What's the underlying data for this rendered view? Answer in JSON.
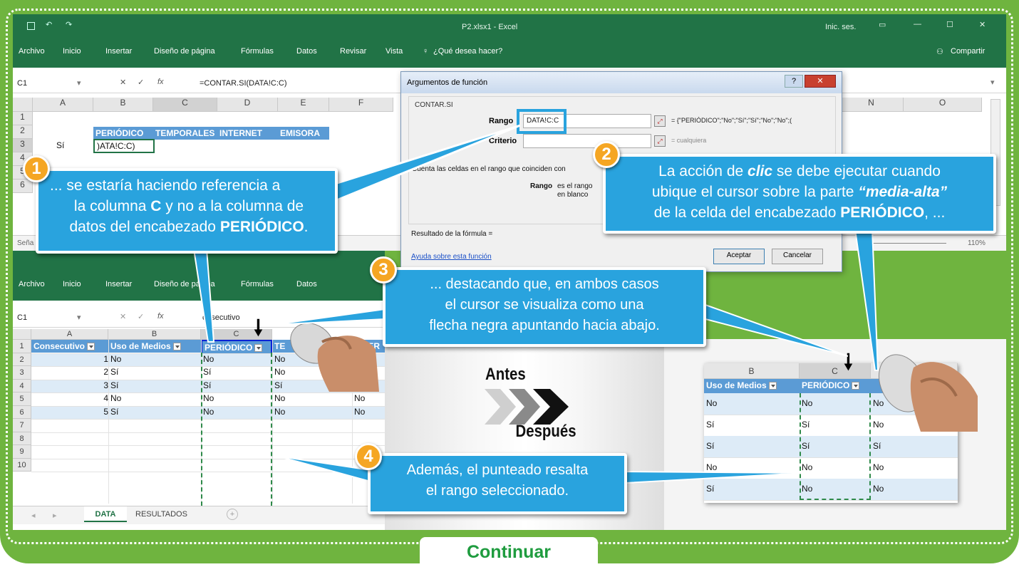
{
  "top_excel": {
    "title": "P2.xlsx1 - Excel",
    "signin": "Inic. ses.",
    "menu": [
      "Archivo",
      "Inicio",
      "Insertar",
      "Diseño de página",
      "Fórmulas",
      "Datos",
      "Revisar",
      "Vista"
    ],
    "search": "¿Qué desea hacer?",
    "share": "Compartir",
    "namebox": "C1",
    "formula": "=CONTAR.SI(DATA!C:C)",
    "cols": [
      "A",
      "B",
      "C",
      "D",
      "E",
      "F"
    ],
    "right_cols": [
      "N",
      "O"
    ],
    "rows": [
      "1",
      "2",
      "3",
      "4",
      "5",
      "6"
    ],
    "row2_b": "PERIÓDICO",
    "row2_c": "TEMPORALES",
    "row2_d": "INTERNET",
    "row2_e": "EMISORA",
    "row3_a": "Sí",
    "row3_b": ")ATA!C:C)",
    "status": "Seña",
    "zoom": "110%"
  },
  "dialog": {
    "title": "Argumentos de función",
    "func": "CONTAR.SI",
    "rango_label": "Rango",
    "rango_value": "DATA!C:C",
    "rango_result": "= {\"PERIÓDICO\";\"No\";\"Sí\";\"Sí\";\"No\";\"No\";(",
    "criterio_label": "Criterio",
    "criterio_result": "= cualquiera",
    "desc": "Cuenta las celdas en el rango que coinciden con",
    "rango_desc_label": "Rango",
    "rango_desc": "es el rango",
    "rango_desc2": "en blanco",
    "result_label": "Resultado de la fórmula =",
    "help_link": "Ayuda sobre esta función",
    "ok": "Aceptar",
    "cancel": "Cancelar"
  },
  "bottom_excel": {
    "menu": [
      "Archivo",
      "Inicio",
      "Insertar",
      "Diseño de página",
      "Fórmulas",
      "Datos"
    ],
    "namebox": "C1",
    "formula": "onsecutivo",
    "cols": [
      "A",
      "B",
      "C"
    ],
    "rows": [
      "1",
      "2",
      "3",
      "4",
      "5",
      "6",
      "7",
      "8",
      "9",
      "10"
    ],
    "headers": [
      "Consecutivo",
      "Uso de Medios",
      "PERIÓDICO",
      "TE",
      "INTER"
    ],
    "data": [
      [
        "1",
        "No",
        "No",
        "No",
        "No"
      ],
      [
        "2",
        "Sí",
        "Sí",
        "No",
        "No"
      ],
      [
        "3",
        "Sí",
        "Sí",
        "Sí",
        "No"
      ],
      [
        "4",
        "No",
        "No",
        "No",
        "No"
      ],
      [
        "5",
        "Sí",
        "No",
        "No",
        "No"
      ]
    ],
    "sheet_tabs": [
      "DATA",
      "RESULTADOS"
    ]
  },
  "right_excerpt": {
    "cols": [
      "B",
      "C"
    ],
    "headers": [
      "Uso de Medios",
      "PERIÓDICO"
    ],
    "data": [
      [
        "No",
        "No",
        "No"
      ],
      [
        "Sí",
        "Sí",
        "No"
      ],
      [
        "Sí",
        "Sí",
        "Sí"
      ],
      [
        "No",
        "No",
        "No"
      ],
      [
        "Sí",
        "No",
        "No"
      ]
    ]
  },
  "antes": "Antes",
  "despues": "Después",
  "callouts": {
    "c1_num": "1",
    "c1_a": "... se estaría haciendo referencia a",
    "c1_b1": "la columna ",
    "c1_b2": "C",
    "c1_b3": " y no a la columna de",
    "c1_c1": "datos del encabezado ",
    "c1_c2": "PERIÓDICO",
    "c1_c3": ".",
    "c2_num": "2",
    "c2_a1": "La acción de ",
    "c2_a2": "clic",
    "c2_a3": " se debe ejecutar cuando",
    "c2_b1": "ubique el cursor sobre la parte ",
    "c2_b2": "“media-alta”",
    "c2_c1": "de la celda del encabezado ",
    "c2_c2": "PERIÓDICO",
    "c2_c3": ", ...",
    "c3_num": "3",
    "c3_a": "... destacando que, en ambos casos",
    "c3_b": "el cursor se visualiza como una",
    "c3_c": "flecha negra apuntando hacia abajo.",
    "c4_num": "4",
    "c4_a": "Además, el punteado resalta",
    "c4_b": "el rango seleccionado."
  },
  "continue_button": "Continuar",
  "colors": {
    "green_frame": "#6fb43f",
    "excel_green": "#217346",
    "callout_blue": "#29a3de",
    "badge_orange": "#f5a623",
    "continue_text": "#1f9c3f"
  }
}
